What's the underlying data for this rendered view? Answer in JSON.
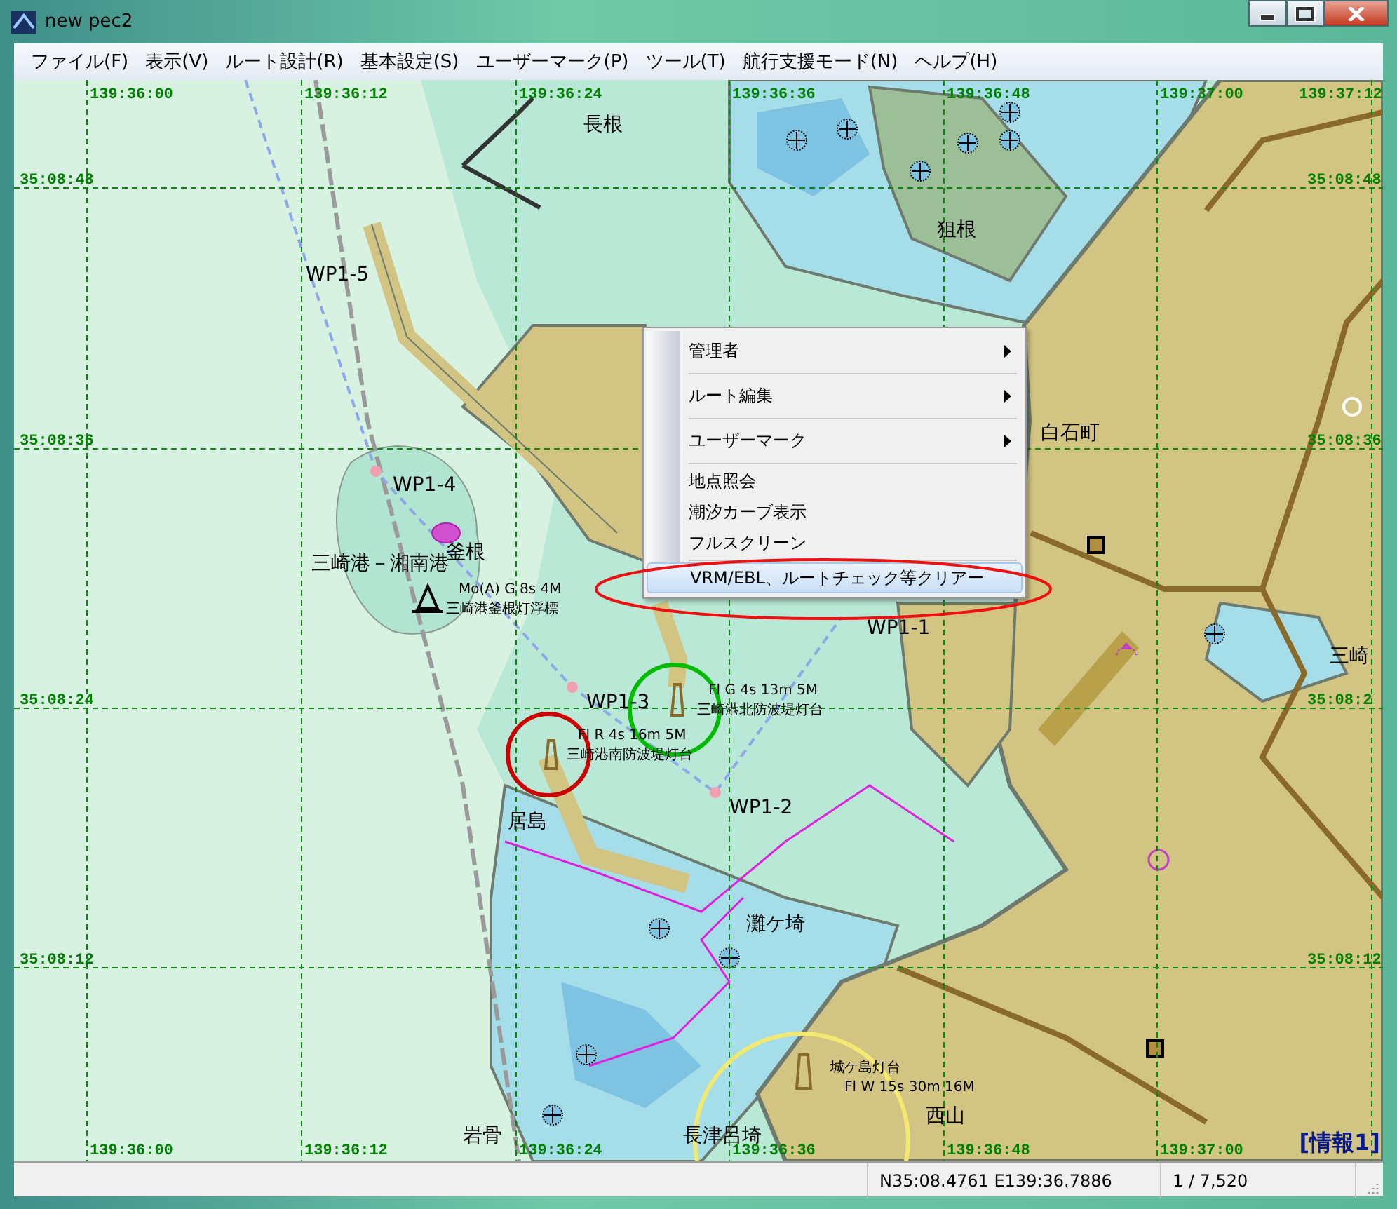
{
  "window": {
    "title": "new pec2"
  },
  "menu_bar": [
    "ファイル(F)",
    "表示(V)",
    "ルート設計(R)",
    "基本設定(S)",
    "ユーザーマーク(P)",
    "ツール(T)",
    "航行支援モード(N)",
    "ヘルプ(H)"
  ],
  "chart": {
    "lon_labels_top": [
      "139:36:00",
      "139:36:12",
      "139:36:24",
      "139:36:36",
      "139:36:48",
      "139:37:00",
      "139:37:12"
    ],
    "lon_labels_bottom": [
      "139:36:00",
      "139:36:12",
      "139:36:24",
      "139:36:36",
      "139:36:48",
      "139:37:00"
    ],
    "lat_labels_left": [
      "35:08:48",
      "35:08:36",
      "35:08:24",
      "35:08:12"
    ],
    "lat_labels_right": [
      "35:08:48",
      "35:08:36",
      "35:08:2",
      "35:08:12"
    ],
    "labels": [
      {
        "kind": "place",
        "text": "長根"
      },
      {
        "kind": "place",
        "text": "狙根"
      },
      {
        "kind": "place",
        "text": "白石町"
      },
      {
        "kind": "place",
        "text": "三崎港－湘南港"
      },
      {
        "kind": "place",
        "text": "釜根"
      },
      {
        "kind": "place",
        "text": "居島"
      },
      {
        "kind": "place",
        "text": "灘ケ埼"
      },
      {
        "kind": "place",
        "text": "岩骨"
      },
      {
        "kind": "place",
        "text": "長津呂埼"
      },
      {
        "kind": "place",
        "text": "西山"
      },
      {
        "kind": "place",
        "text": "三崎"
      },
      {
        "kind": "waypoint",
        "text": "WP1-5"
      },
      {
        "kind": "waypoint",
        "text": "WP1-4"
      },
      {
        "kind": "waypoint",
        "text": "WP1-3"
      },
      {
        "kind": "waypoint",
        "text": "WP1-2"
      },
      {
        "kind": "waypoint",
        "text": "WP1-1"
      },
      {
        "kind": "light",
        "text": "Mo(A) G 8s 4M"
      },
      {
        "kind": "light",
        "text": "三崎港釜根灯浮標"
      },
      {
        "kind": "light",
        "text": "Fl G 4s 13m 5M"
      },
      {
        "kind": "light",
        "text": "三崎港北防波堤灯台"
      },
      {
        "kind": "light",
        "text": "Fl R 4s 16m 5M"
      },
      {
        "kind": "light",
        "text": "三崎港南防波堤灯台"
      },
      {
        "kind": "light",
        "text": "城ケ島灯台"
      },
      {
        "kind": "light",
        "text": "Fl W 15s 30m 16M"
      }
    ],
    "info_label": "[情報1]"
  },
  "context_menu": [
    {
      "kind": "item",
      "label": "管理者",
      "submenu": true,
      "selected": false
    },
    {
      "kind": "separator"
    },
    {
      "kind": "item",
      "label": "ルート編集",
      "submenu": true,
      "selected": false
    },
    {
      "kind": "separator"
    },
    {
      "kind": "item",
      "label": "ユーザーマーク",
      "submenu": true,
      "selected": false
    },
    {
      "kind": "separator"
    },
    {
      "kind": "item",
      "label": "地点照会",
      "submenu": false,
      "selected": false
    },
    {
      "kind": "item",
      "label": "潮汐カーブ表示",
      "submenu": false,
      "selected": false
    },
    {
      "kind": "item",
      "label": "フルスクリーン",
      "submenu": false,
      "selected": false
    },
    {
      "kind": "separator"
    },
    {
      "kind": "item",
      "label": "VRM/EBL、ルートチェック等クリアー",
      "submenu": false,
      "selected": true
    }
  ],
  "status_bar": {
    "position": "N35:08.4761 E139:36.7886",
    "scale": "1 / 7,520"
  }
}
